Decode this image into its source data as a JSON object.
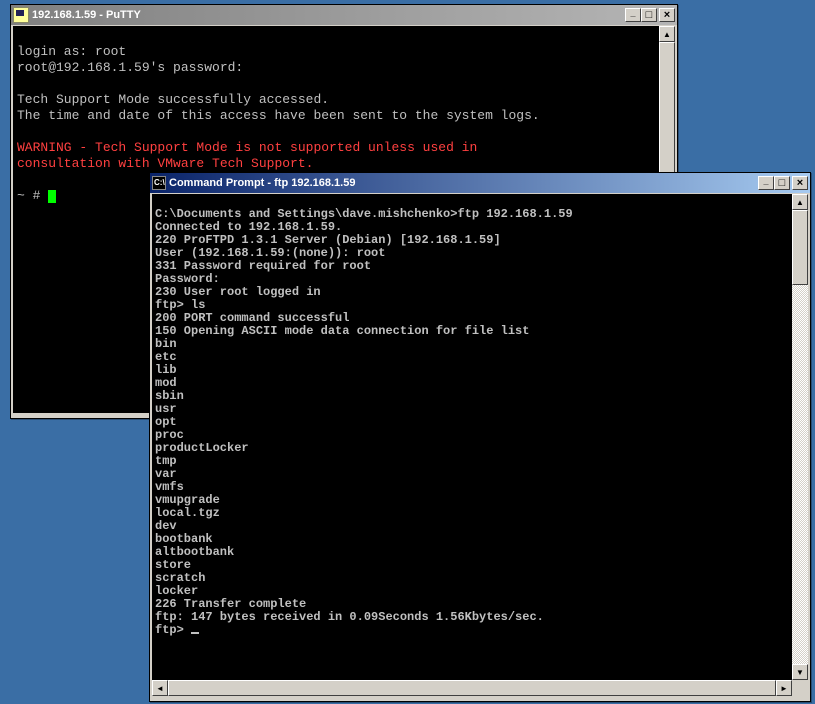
{
  "putty": {
    "title": "192.168.1.59 - PuTTY",
    "lines": {
      "l1": "login as: root",
      "l2": "root@192.168.1.59's password:",
      "l3": "",
      "l4": "Tech Support Mode successfully accessed.",
      "l5": "The time and date of this access have been sent to the system logs.",
      "l6": "",
      "w1": "WARNING - Tech Support Mode is not supported unless used in",
      "w2": "consultation with VMware Tech Support.",
      "l7": "",
      "prompt": "~ # "
    }
  },
  "cmd": {
    "title": "Command Prompt - ftp 192.168.1.59",
    "icon_text": "C:\\",
    "lines": {
      "l1": "C:\\Documents and Settings\\dave.mishchenko>ftp 192.168.1.59",
      "l2": "Connected to 192.168.1.59.",
      "l3": "220 ProFTPD 1.3.1 Server (Debian) [192.168.1.59]",
      "l4": "User (192.168.1.59:(none)): root",
      "l5": "331 Password required for root",
      "l6": "Password:",
      "l7": "230 User root logged in",
      "l8": "ftp> ls",
      "l9": "200 PORT command successful",
      "l10": "150 Opening ASCII mode data connection for file list",
      "l11": "bin",
      "l12": "etc",
      "l13": "lib",
      "l14": "mod",
      "l15": "sbin",
      "l16": "usr",
      "l17": "opt",
      "l18": "proc",
      "l19": "productLocker",
      "l20": "tmp",
      "l21": "var",
      "l22": "vmfs",
      "l23": "vmupgrade",
      "l24": "local.tgz",
      "l25": "dev",
      "l26": "bootbank",
      "l27": "altbootbank",
      "l28": "store",
      "l29": "scratch",
      "l30": "locker",
      "l31": "226 Transfer complete",
      "l32": "ftp: 147 bytes received in 0.09Seconds 1.56Kbytes/sec.",
      "l33": "ftp> "
    }
  },
  "buttons": {
    "min": "_",
    "max": "□",
    "close": "×",
    "up": "▲",
    "down": "▼",
    "left": "◄",
    "right": "►"
  }
}
